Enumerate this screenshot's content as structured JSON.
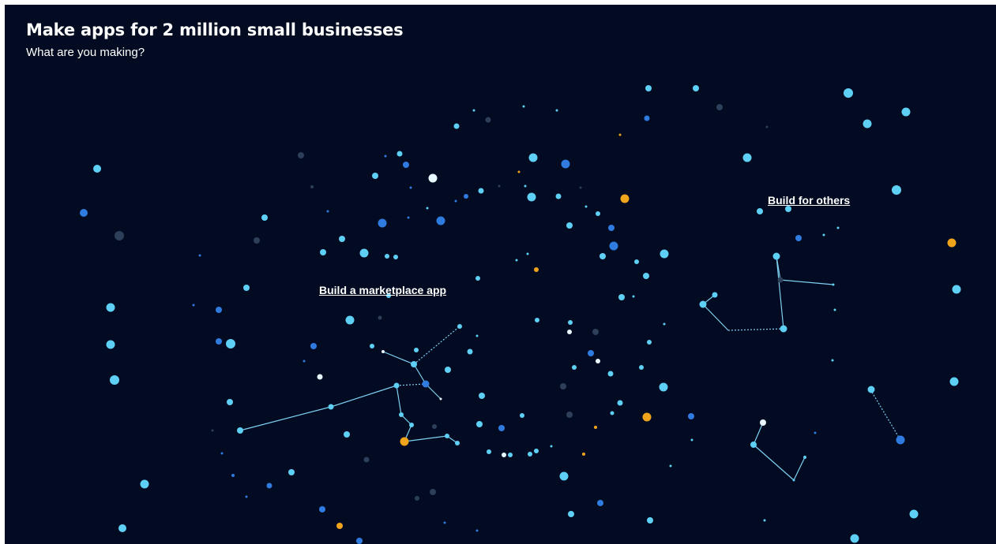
{
  "header": {
    "title": "Make apps for 2 million small businesses",
    "subtitle": "What are you making?"
  },
  "links": {
    "marketplace": "Build a marketplace app",
    "others": "Build for others"
  },
  "colors": {
    "background": "#020b21",
    "star_cyan": "#5fd0f5",
    "star_blue": "#2f7be0",
    "star_amber": "#f0a41c",
    "star_dim": "#2d3f5a",
    "star_white": "#e8f8ff",
    "line": "#7ed0f2"
  }
}
